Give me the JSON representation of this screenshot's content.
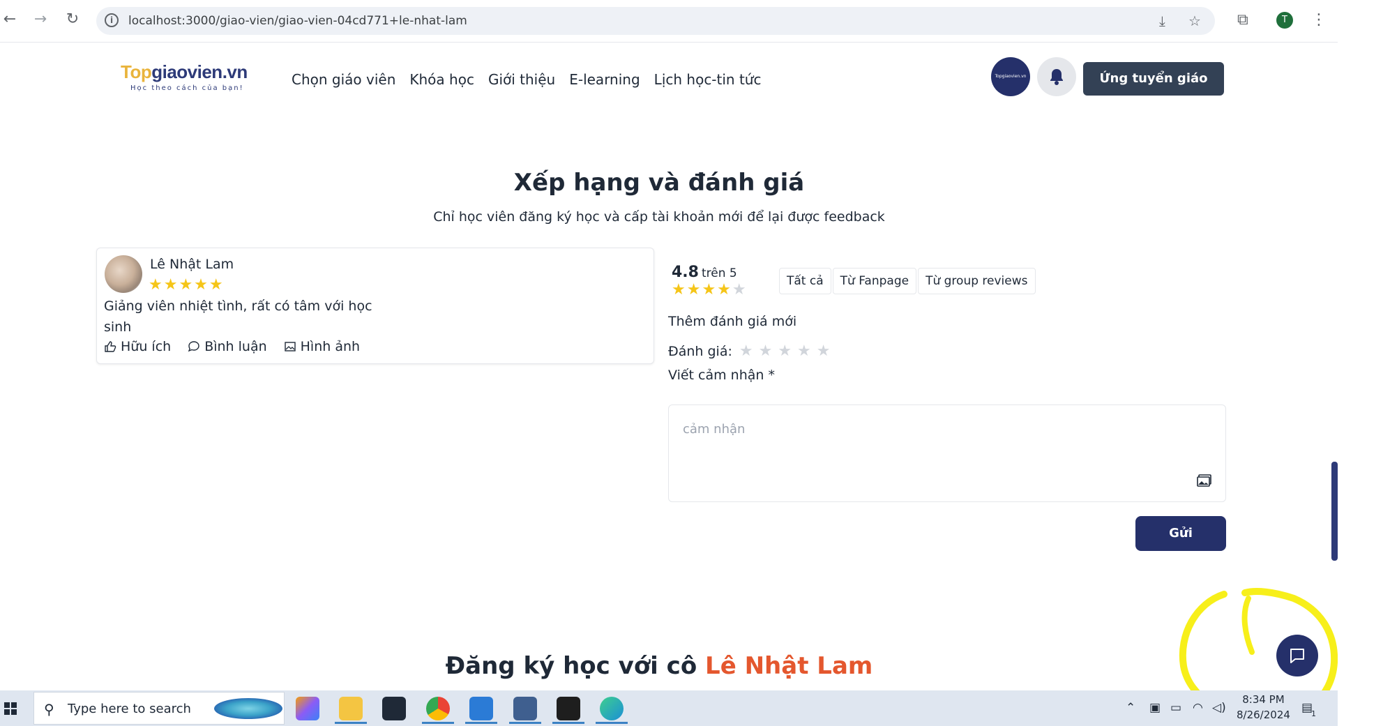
{
  "browser": {
    "url": "localhost:3000/giao-vien/giao-vien-04cd771+le-nhat-lam",
    "profile_initial": "T"
  },
  "header": {
    "logo_top": "Top",
    "logo_rest": "giaovien.vn",
    "logo_tagline": "Học theo cách của bạn!",
    "menu": [
      "Chọn giáo viên",
      "Khóa học",
      "Giới thiệu",
      "E-learning",
      "Lịch học-tin tức"
    ],
    "apply_button": "Ứng tuyển giáo viên"
  },
  "ratings_section": {
    "title": "Xếp hạng và đánh giá",
    "subtitle": "Chỉ học viên đăng ký học và cấp tài khoản mới để lại được feedback"
  },
  "review": {
    "name": "Lê Nhật Lam",
    "stars": 5,
    "text": "Giảng viên nhiệt tình, rất có tâm với học sinh",
    "actions": {
      "helpful": "Hữu ích",
      "comment": "Bình luận",
      "images": "Hình ảnh"
    }
  },
  "summary": {
    "score": "4.8",
    "out_of": "trên 5",
    "filled_stars": 4,
    "filters": [
      "Tất cả",
      "Từ Fanpage",
      "Từ group reviews"
    ]
  },
  "form": {
    "add_title": "Thêm đánh giá mới",
    "rate_label": "Đánh giá:",
    "write_label": "Viết cảm nhận *",
    "placeholder": "cảm nhận",
    "submit": "Gửi"
  },
  "register": {
    "prefix": "Đăng ký học với cô",
    "teacher": "Lê Nhật Lam"
  },
  "taskbar": {
    "search_placeholder": "Type here to search",
    "time": "8:34 PM",
    "date": "8/26/2024",
    "notification_count": "1"
  },
  "colors": {
    "primary": "#25306a",
    "apply_button": "#334155",
    "star": "#f5c518",
    "teacher_name": "#e4572e",
    "highlight": "#f7ef1a"
  }
}
